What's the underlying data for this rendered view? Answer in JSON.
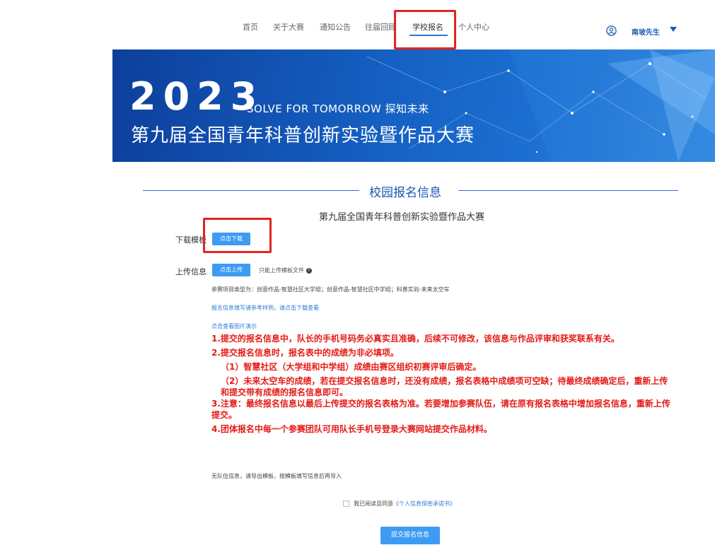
{
  "nav": {
    "items": [
      {
        "label": "首页"
      },
      {
        "label": "关于大赛"
      },
      {
        "label": "通知公告"
      },
      {
        "label": "往届回顾"
      },
      {
        "label": "学校报名",
        "active": true
      },
      {
        "label": "个人中心"
      }
    ],
    "user": {
      "name": "南坡先生",
      "icon": "user-circle-icon",
      "dropdown_icon": "caret-down-icon"
    }
  },
  "banner": {
    "year": "2023",
    "slogan": "SOLVE FOR TOMORROW  探知未来",
    "title": "第九届全国青年科普创新实验暨作品大赛"
  },
  "section": {
    "title": "校园报名信息",
    "contest_name": "第九届全国青年科普创新实验暨作品大赛"
  },
  "form": {
    "download_label": "下载模板",
    "download_button": "点击下载",
    "upload_label": "上传信息",
    "upload_button": "点击上传",
    "upload_hint": "只能上传模板文件",
    "types_text": "参赛项目类型为：创意作品-智慧社区大学组；创意作品-智慧社区中学组；科普实验-未来太空车",
    "sample_link": "报名信息填写请参考样例，请点击下载查看",
    "image_demo_link": "点击查看图片演示"
  },
  "notes": [
    "1.提交的报名信息中，队长的手机号码务必真实且准确，后续不可修改，该信息与作品评审和获奖联系有关。",
    "2.提交报名信息时，报名表中的成绩为非必填项。",
    "（1）智慧社区（大学组和中学组）成绩由赛区组织初赛评审后确定。",
    "（2）未来太空车的成绩，若在提交报名信息时，还没有成绩，报名表格中成绩项可空缺；待最终成绩确定后，重新上传和提交带有成绩的报名信息即可。",
    "3.注意：最终报名信息以最后上传提交的报名表格为准。若要增加参赛队伍，请在原有报名表格中增加报名信息，重新上传提交。",
    "4.团体报名中每一个参赛团队可用队长手机号登录大赛网站提交作品材料。"
  ],
  "no_team_text": "无队伍信息，请导出模板，按模板填写信息后再导入",
  "agree": {
    "text": "我已阅读且同意",
    "document": "《个人信息保密承诺书》"
  },
  "submit_label": "提交报名信息",
  "colors": {
    "accent": "#3d9bf2",
    "notice_red": "#e41b17",
    "link_blue": "#2d7ad6",
    "highlight_box": "#e0261f"
  }
}
